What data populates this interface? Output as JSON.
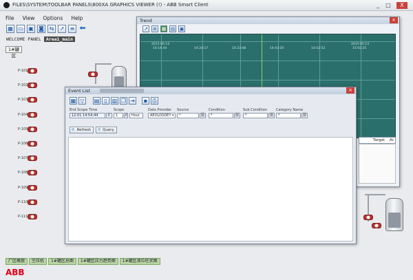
{
  "window": {
    "title": "FILES\\SYSTEM\\TOOLBAR PANELS\\800XA GRAPHICS VIEWER (!) - ABB Smart Client",
    "controls": [
      "_",
      "□",
      "X"
    ]
  },
  "menu": [
    "File",
    "View",
    "Options",
    "Help"
  ],
  "toolbar_icons": [
    "chart-icon",
    "window-icon",
    "display-icon",
    "camera-icon",
    "sync-icon",
    "trend-icon",
    "list-icon",
    "back-arrow-icon"
  ],
  "panel": {
    "label": "WELCOME PANEL",
    "area": "Area1_main",
    "area_button": "1#罐区"
  },
  "pumps": [
    "P-101",
    "P-102",
    "P-103",
    "P-104",
    "P-105",
    "P-106",
    "P-107",
    "P-108",
    "P-109",
    "P-110",
    "P-111"
  ],
  "trend": {
    "title": "Trend",
    "times": [
      "14:14:44",
      "14:24:17",
      "14:33:48",
      "14:43:20",
      "14:52:52",
      "15:02:25"
    ],
    "dates": [
      "2015-05-13",
      "2015-05-13"
    ],
    "grid_color": "#5d9f99",
    "plot_bg": "#2a6f6b"
  },
  "event_list": {
    "title": "Event List",
    "fields": {
      "end_time": {
        "label": "End Scope Time",
        "value": "12:01 14:54:44"
      },
      "scope": {
        "label": "Scope",
        "value": "1",
        "unit": "Hour"
      },
      "provider": {
        "label": "Data Provider",
        "value": "AEOLDSDEY"
      },
      "source": {
        "label": "Source",
        "value": "*"
      },
      "condition": {
        "label": "Condition",
        "value": "*"
      },
      "subcondition": {
        "label": "Sub Condition",
        "value": "*"
      },
      "category": {
        "label": "Category Name",
        "value": "*"
      }
    },
    "buttons": {
      "refresh": "Refresh",
      "query": "Query"
    }
  },
  "behind_table": {
    "col_target": "Target",
    "col_last": "Ar"
  },
  "bottom_tabs": [
    "厂区概貌",
    "空压机",
    "1#罐区总图",
    "1#罐区压力趋势图",
    "1#罐区液位柱状图"
  ],
  "logo": "ABB",
  "colors": {
    "accent": "#2c6ab5",
    "tab_bg": "#b9d6a4",
    "abb_red": "#e2001a"
  }
}
